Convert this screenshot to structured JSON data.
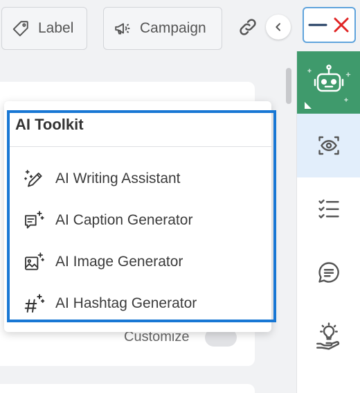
{
  "toolbar": {
    "label_button": "Label",
    "campaign_button": "Campaign"
  },
  "content": {
    "customize_label": "Customize"
  },
  "ai_toolkit": {
    "title": "AI Toolkit",
    "items": [
      {
        "label": "AI Writing Assistant",
        "icon": "pen-sparkle-icon"
      },
      {
        "label": "AI Caption Generator",
        "icon": "caption-sparkle-icon"
      },
      {
        "label": "AI Image Generator",
        "icon": "image-sparkle-icon"
      },
      {
        "label": "AI Hashtag Generator",
        "icon": "hashtag-sparkle-icon"
      }
    ]
  },
  "rail": {
    "items": [
      "robot-icon",
      "eye-scan-icon",
      "checklist-icon",
      "message-icon",
      "idea-icon"
    ]
  },
  "colors": {
    "accent_green": "#3f9a6c",
    "highlight_blue": "#1877d4",
    "close_red": "#e02424",
    "active_rail_bg": "#e2eefb"
  }
}
